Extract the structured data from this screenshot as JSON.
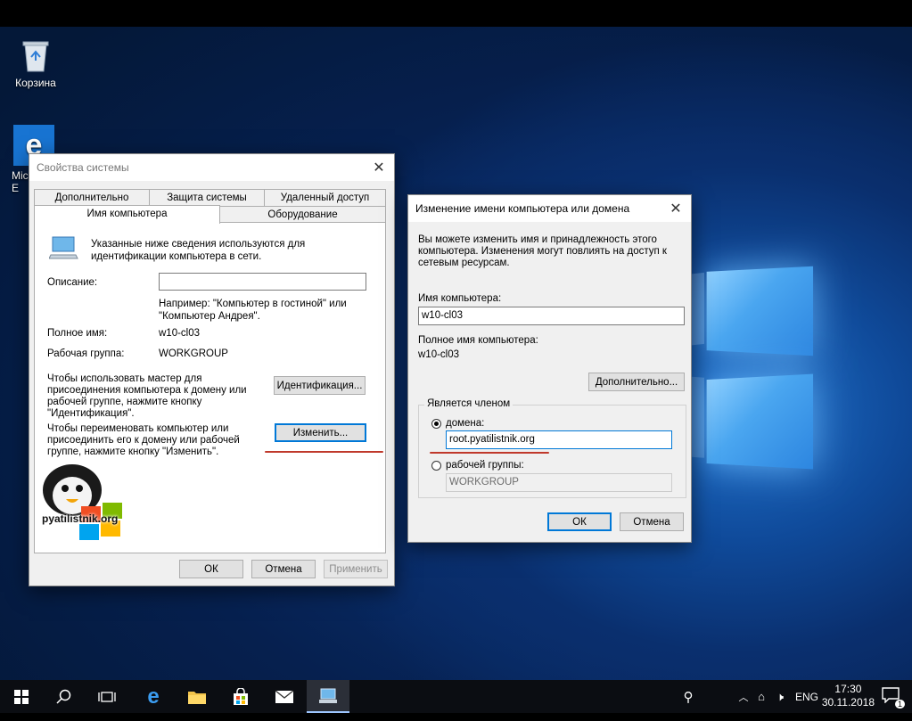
{
  "desktop": {
    "recycle_bin_label": "Корзина",
    "edge_label_partial": "Mic",
    "edge_label_partial2": "E"
  },
  "system_properties": {
    "title": "Свойства системы",
    "tabs_row1": [
      "Дополнительно",
      "Защита системы",
      "Удаленный доступ"
    ],
    "tabs_row2": [
      "Имя компьютера",
      "Оборудование"
    ],
    "active_tab": "Имя компьютера",
    "intro_line1": "Указанные ниже сведения используются для",
    "intro_line2": "идентификации компьютера в сети.",
    "description_label": "Описание:",
    "description_value": "",
    "example_line1": "Например: \"Компьютер в гостиной\" или",
    "example_line2": "\"Компьютер Андрея\".",
    "full_name_label": "Полное имя:",
    "full_name_value": "w10-cl03",
    "workgroup_label": "Рабочая группа:",
    "workgroup_value": "WORKGROUP",
    "wizard_text": [
      "Чтобы использовать мастер для",
      "присоединения компьютера к домену или",
      "рабочей группе, нажмите кнопку",
      "\"Идентификация\"."
    ],
    "identify_button": "Идентификация...",
    "rename_text": [
      "Чтобы переименовать компьютер или",
      "присоединить его к домену или рабочей",
      "группе, нажмите кнопку \"Изменить\"."
    ],
    "change_button": "Изменить...",
    "watermark": "pyatilistnik.org",
    "ok_button": "ОК",
    "cancel_button": "Отмена",
    "apply_button": "Применить"
  },
  "rename_dialog": {
    "title": "Изменение имени компьютера или домена",
    "intro": [
      "Вы можете изменить имя и принадлежность этого",
      "компьютера. Изменения могут повлиять на доступ к",
      "сетевым ресурсам."
    ],
    "computer_name_label": "Имя компьютера:",
    "computer_name_value": "w10-cl03",
    "full_name_label": "Полное имя компьютера:",
    "full_name_value": "w10-cl03",
    "more_button": "Дополнительно...",
    "member_of_label": "Является членом",
    "domain_label": "домена:",
    "domain_value": "root.pyatilistnik.org",
    "workgroup_label": "рабочей группы:",
    "workgroup_value": "WORKGROUP",
    "selected_membership": "domain",
    "ok_button": "ОК",
    "cancel_button": "Отмена"
  },
  "taskbar": {
    "language": "ENG",
    "time": "17:30",
    "date": "30.11.2018",
    "notification_count": "1"
  },
  "colors": {
    "accent": "#0078d7",
    "annotation_red": "#c0392b"
  }
}
